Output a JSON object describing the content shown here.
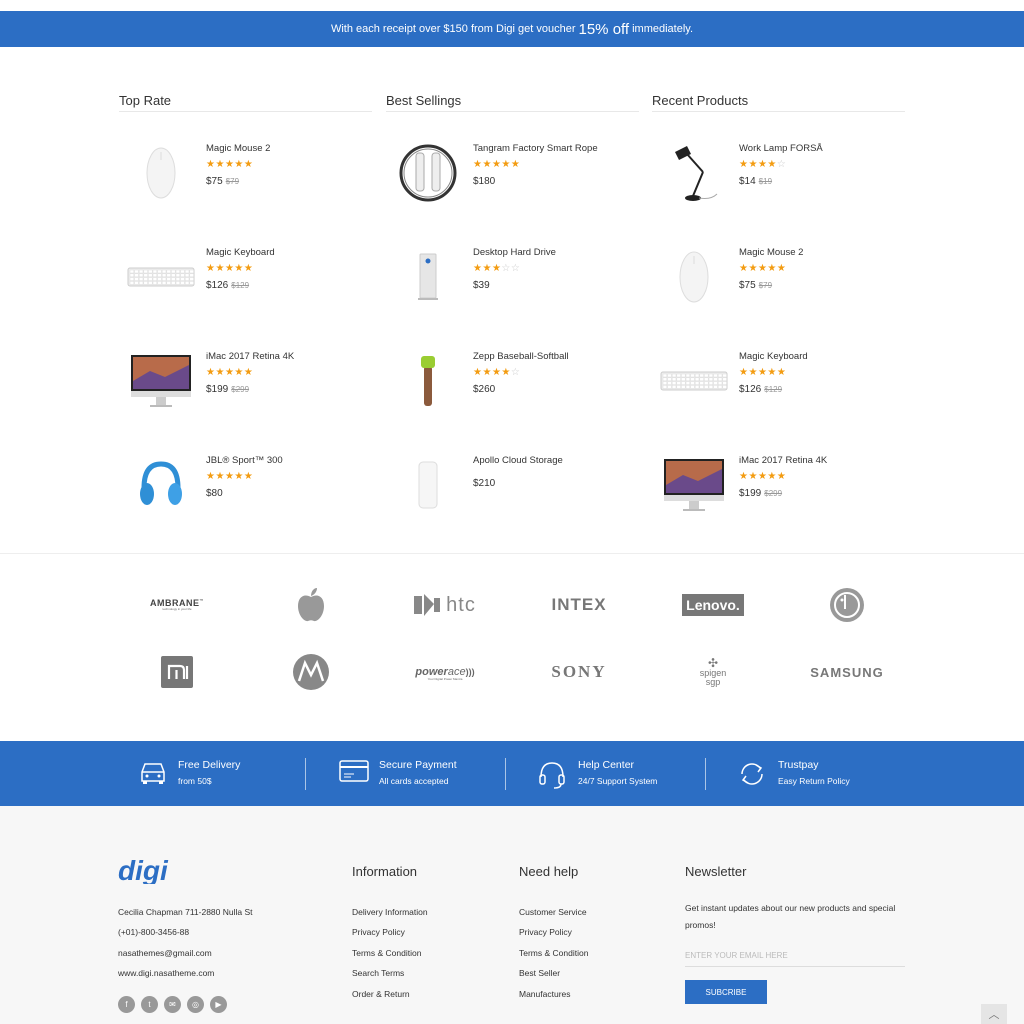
{
  "promo": {
    "pre": "With each receipt over $150 from Digi get voucher",
    "highlight": "15% off",
    "post": "immediately."
  },
  "columns": [
    {
      "title": "Top Rate",
      "products": [
        {
          "name": "Magic Mouse 2",
          "rating": 5,
          "price": "$75",
          "old_price": "$79",
          "icon": "mouse-icon"
        },
        {
          "name": "Magic Keyboard",
          "rating": 5,
          "price": "$126",
          "old_price": "$129",
          "icon": "keyboard-icon"
        },
        {
          "name": "iMac 2017 Retina 4K",
          "rating": 5,
          "price": "$199",
          "old_price": "$299",
          "icon": "imac-icon"
        },
        {
          "name": "JBL® Sport™ 300",
          "rating": 5,
          "price": "$80",
          "old_price": "",
          "icon": "headphones-icon"
        }
      ]
    },
    {
      "title": "Best Sellings",
      "products": [
        {
          "name": "Tangram Factory Smart Rope",
          "rating": 5,
          "price": "$180",
          "old_price": "",
          "icon": "rope-icon"
        },
        {
          "name": "Desktop Hard Drive",
          "rating": 3,
          "price": "$39",
          "old_price": "",
          "icon": "hard-drive-icon"
        },
        {
          "name": "Zepp Baseball-Softball",
          "rating": 4,
          "price": "$260",
          "old_price": "",
          "icon": "bat-sensor-icon"
        },
        {
          "name": "Apollo Cloud Storage",
          "rating": null,
          "price": "$210",
          "old_price": "",
          "icon": "cloud-storage-icon"
        }
      ]
    },
    {
      "title": "Recent Products",
      "products": [
        {
          "name": "Work Lamp FORSÅ",
          "rating": 4,
          "price": "$14",
          "old_price": "$19",
          "icon": "lamp-icon"
        },
        {
          "name": "Magic Mouse 2",
          "rating": 5,
          "price": "$75",
          "old_price": "$79",
          "icon": "mouse-icon"
        },
        {
          "name": "Magic Keyboard",
          "rating": 5,
          "price": "$126",
          "old_price": "$129",
          "icon": "keyboard-icon"
        },
        {
          "name": "iMac 2017 Retina 4K",
          "rating": 5,
          "price": "$199",
          "old_price": "$299",
          "icon": "imac-icon"
        }
      ]
    }
  ],
  "brands": [
    "AMBRANE",
    "apple-logo",
    "htc",
    "INTEX",
    "Lenovo",
    "lg-logo",
    "mi-logo",
    "motorola-logo",
    "powerace",
    "SONY",
    "spigen sgp",
    "SAMSUNG"
  ],
  "brand_tagline_ambrane": "technology in your life",
  "brand_tagline_powerace": "Your Digital Power Mantra",
  "features": [
    {
      "title": "Free Delivery",
      "sub": "from 50$",
      "icon": "car-icon"
    },
    {
      "title": "Secure Payment",
      "sub": "All cards accepted",
      "icon": "credit-card-icon"
    },
    {
      "title": "Help Center",
      "sub": "24/7 Support System",
      "icon": "headset-icon"
    },
    {
      "title": "Trustpay",
      "sub": "Easy Return Policy",
      "icon": "refresh-icon"
    }
  ],
  "footer": {
    "logo": "digi",
    "address": "Cecilia Chapman 711-2880 Nulla St",
    "phone": "(+01)-800-3456-88",
    "email": "nasathemes@gmail.com",
    "website": "www.digi.nasatheme.com",
    "social": [
      "facebook-icon",
      "twitter-icon",
      "email-icon",
      "instagram-icon",
      "youtube-icon"
    ],
    "social_glyphs": [
      "f",
      "t",
      "✉",
      "◎",
      "▶"
    ],
    "information": {
      "title": "Information",
      "links": [
        "Delivery Information",
        "Privacy Policy",
        "Terms & Condition",
        "Search Terms",
        "Order & Return"
      ]
    },
    "help": {
      "title": "Need help",
      "links": [
        "Customer Service",
        "Privacy Policy",
        "Terms & Condition",
        "Best Seller",
        "Manufactures"
      ]
    },
    "newsletter": {
      "title": "Newsletter",
      "text": "Get instant updates about our new products and special promos!",
      "placeholder": "ENTER YOUR EMAIL HERE",
      "button": "SUBCRIBE"
    }
  },
  "colors": {
    "accent": "#2c6ec4",
    "star": "#f39c12"
  }
}
